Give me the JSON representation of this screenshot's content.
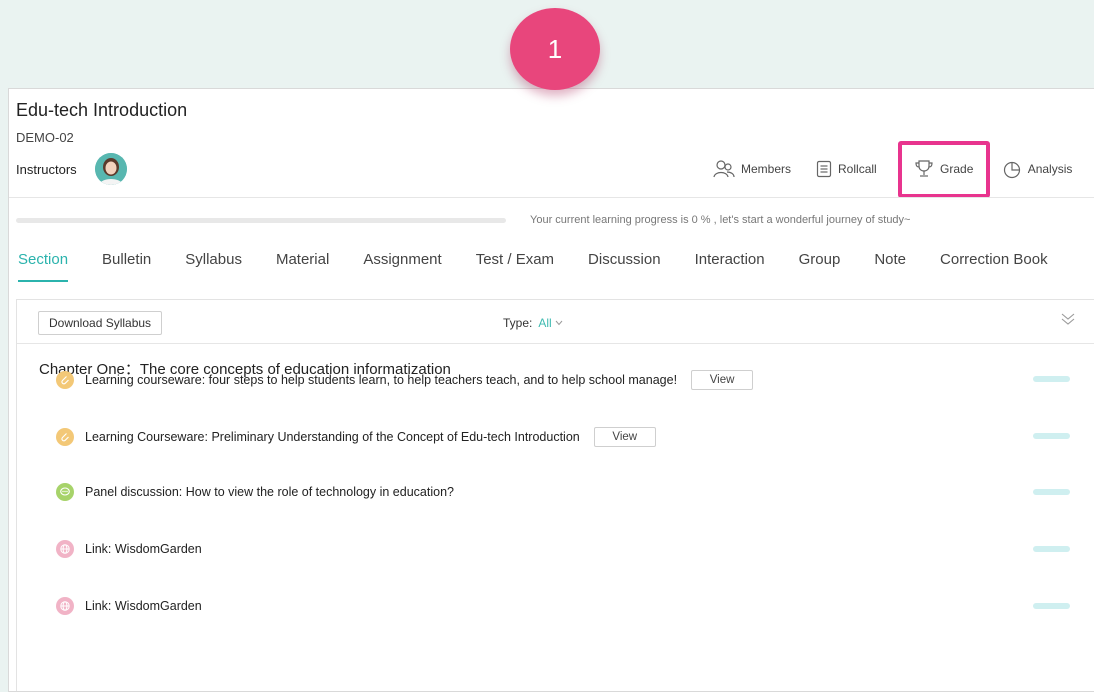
{
  "step_badge": "1",
  "course": {
    "title": "Edu-tech Introduction",
    "code": "DEMO-02",
    "instructors_label": "Instructors"
  },
  "toolbar": {
    "members": "Members",
    "rollcall": "Rollcall",
    "grade": "Grade",
    "analysis": "Analysis"
  },
  "progress": {
    "value": 0,
    "text": "Your current learning progress is 0 % , let's start a wonderful journey of study~"
  },
  "tabs": [
    {
      "label": "Section",
      "active": true
    },
    {
      "label": "Bulletin"
    },
    {
      "label": "Syllabus"
    },
    {
      "label": "Material"
    },
    {
      "label": "Assignment"
    },
    {
      "label": "Test / Exam"
    },
    {
      "label": "Discussion"
    },
    {
      "label": "Interaction"
    },
    {
      "label": "Group"
    },
    {
      "label": "Note"
    },
    {
      "label": "Correction Book"
    }
  ],
  "panel": {
    "download_label": "Download Syllabus",
    "type_label": "Type:",
    "type_value": "All",
    "chapter_title": "Chapter One：The core concepts of education informatization",
    "items": [
      {
        "icon": "courseware-icon",
        "text": "Learning courseware: four steps to help students learn, to help teachers teach, and to help school manage!",
        "view_label": "View"
      },
      {
        "icon": "courseware-icon",
        "text": "Learning Courseware: Preliminary Understanding of the Concept of Edu-tech Introduction",
        "view_label": "View"
      },
      {
        "icon": "discussion-icon",
        "text": "Panel discussion: How to view the role of technology in education?"
      },
      {
        "icon": "link-icon",
        "text": "Link: WisdomGarden"
      },
      {
        "icon": "link-icon",
        "text": "Link: WisdomGarden"
      }
    ]
  },
  "colors": {
    "accent": "#2bb3ad",
    "highlight": "#e8348e",
    "badge": "#e8467c"
  }
}
